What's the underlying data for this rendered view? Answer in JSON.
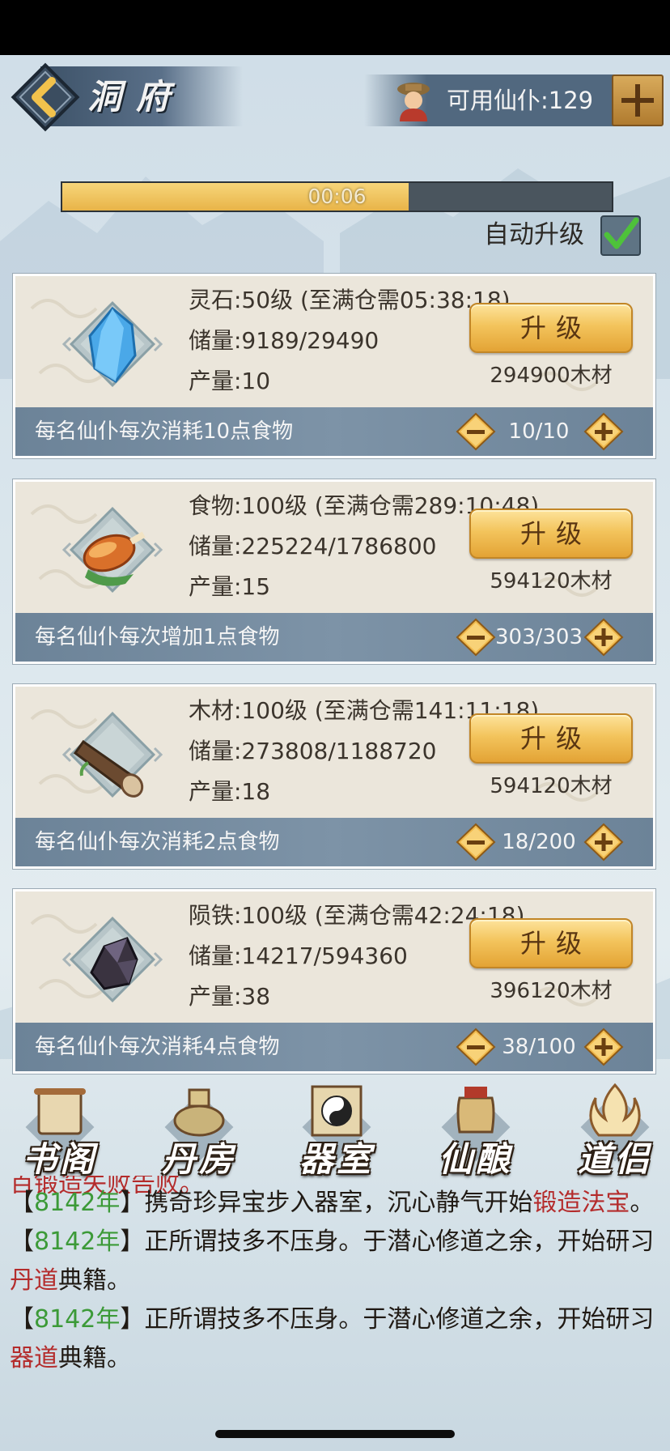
{
  "header": {
    "title": "洞府",
    "workers_label": "可用仙仆:129"
  },
  "progress": {
    "time_text": "00:06",
    "fill_fraction": 0.63
  },
  "auto_upgrade": {
    "label": "自动升级",
    "checked": true
  },
  "resources": [
    {
      "icon": "spirit-stone-icon",
      "title": "灵石:50级 (至满仓需05:38:18)",
      "stock": "储量:9189/29490",
      "output": "产量:10",
      "upgrade_label": "升级",
      "cost": "294900木材",
      "footer": "每名仙仆每次消耗10点食物",
      "count": "10/10"
    },
    {
      "icon": "food-drumstick-icon",
      "title": "食物:100级 (至满仓需289:10:48)",
      "stock": "储量:225224/1786800",
      "output": "产量:15",
      "upgrade_label": "升级",
      "cost": "594120木材",
      "footer": "每名仙仆每次增加1点食物",
      "count": "303/303"
    },
    {
      "icon": "wood-log-icon",
      "title": "木材:100级 (至满仓需141:11:18)",
      "stock": "储量:273808/1188720",
      "output": "产量:18",
      "upgrade_label": "升级",
      "cost": "594120木材",
      "footer": "每名仙仆每次消耗2点食物",
      "count": "18/200"
    },
    {
      "icon": "meteor-iron-icon",
      "title": "陨铁:100级 (至满仓需42:24:18)",
      "stock": "储量:14217/594360",
      "output": "产量:38",
      "upgrade_label": "升级",
      "cost": "396120木材",
      "footer": "每名仙仆每次消耗4点食物",
      "count": "38/100"
    }
  ],
  "nav": [
    {
      "label": "书阁",
      "icon": "scroll-library-icon"
    },
    {
      "label": "丹房",
      "icon": "alchemy-cauldron-icon"
    },
    {
      "label": "器室",
      "icon": "taiji-forge-icon"
    },
    {
      "label": "仙酿",
      "icon": "wine-jar-icon"
    },
    {
      "label": "道侣",
      "icon": "flame-companion-icon"
    }
  ],
  "log": {
    "cut_line": "百锻造失败告败。",
    "entries": [
      {
        "open": "【",
        "year": "8142年",
        "close": "】",
        "text": "携奇珍异宝步入器室，沉心静气开始",
        "highlight": "锻造法宝",
        "tail": "。"
      },
      {
        "open": "【",
        "year": "8142年",
        "close": "】",
        "text": "正所谓技多不压身。于潜心修道之余，开始研习",
        "highlight": "丹道",
        "tail": "典籍。"
      },
      {
        "open": "【",
        "year": "8142年",
        "close": "】",
        "text": "正所谓技多不压身。于潜心修道之余，开始研习",
        "highlight": "器道",
        "tail": "典籍。"
      }
    ]
  },
  "colors": {
    "accent_gold": "#f3c45c",
    "footer_blue": "#7d93a7",
    "year_green": "#3c9a38",
    "highlight_red": "#b42c2c"
  }
}
